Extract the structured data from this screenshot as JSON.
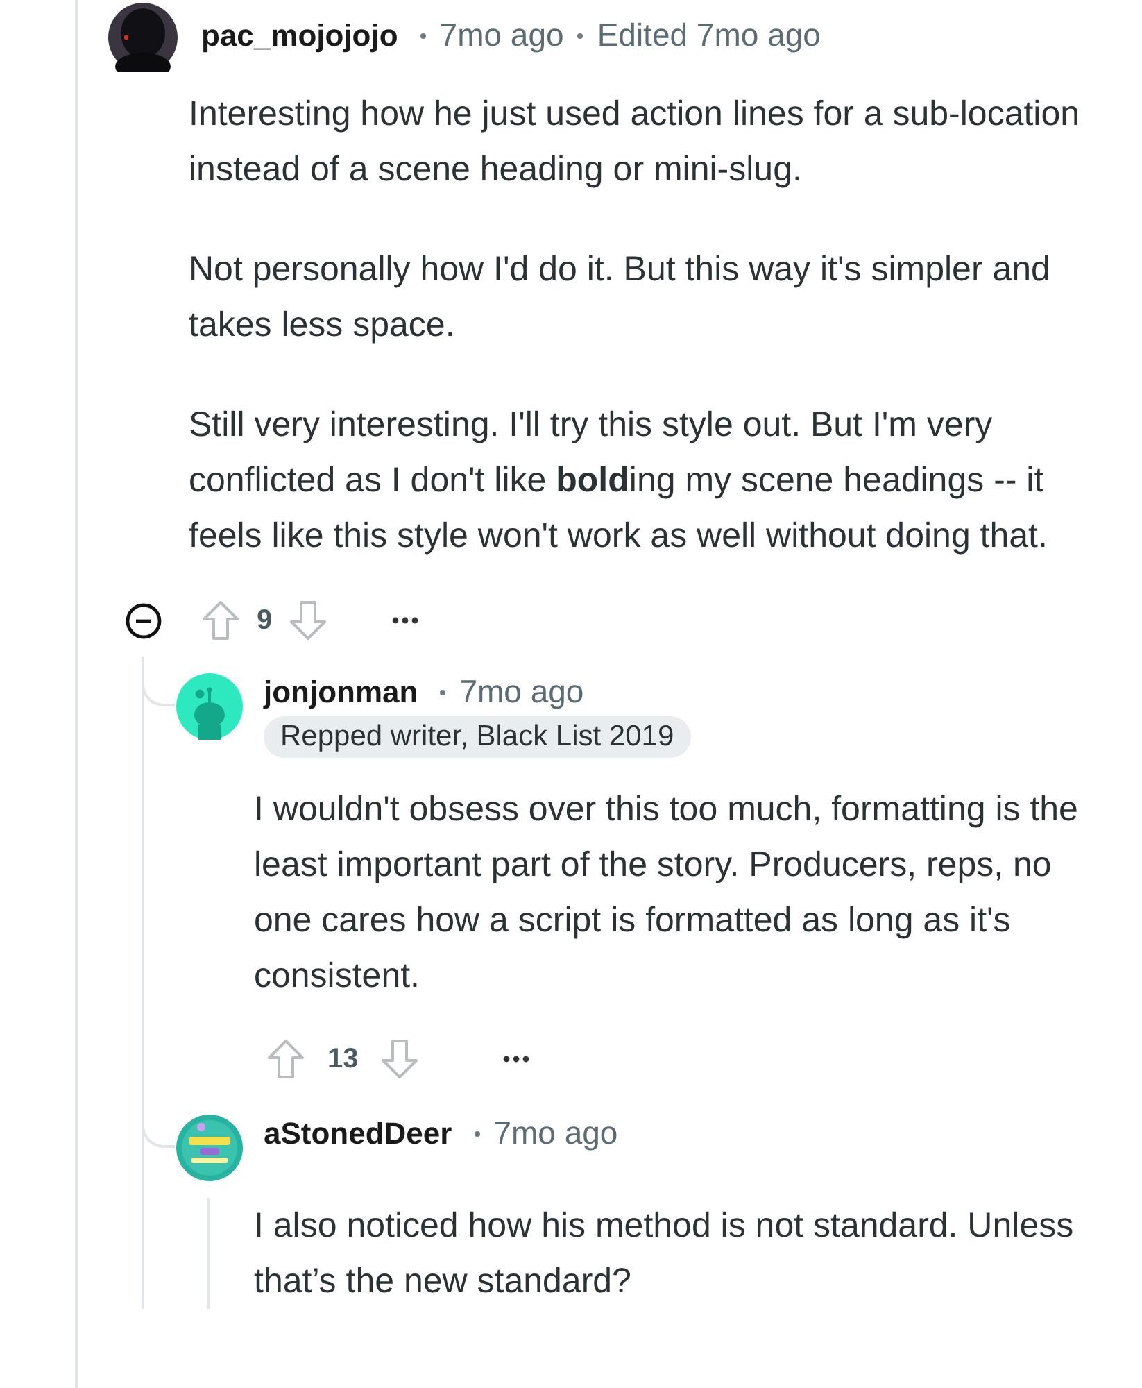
{
  "comments": [
    {
      "author": "pac_mojojojo",
      "avatar": {
        "kind": "dark"
      },
      "meta": [
        "7mo ago",
        "Edited 7mo ago"
      ],
      "paragraphs": [
        "Interesting how he just used action lines for a sub-location instead of a scene heading or mini-slug.",
        "Not personally how I'd do it. But this way it's simpler and takes less space.",
        "Still very interesting. I'll try this style out. But I'm very conflicted as I don't like **bold**ing my scene headings -- it feels like this style won't work as well without doing that."
      ],
      "expanded": true,
      "votes": "9",
      "replies": [
        {
          "author": "jonjonman",
          "avatar": {
            "kind": "snoo"
          },
          "meta": [
            "7mo ago"
          ],
          "flair": "Repped writer, Black List 2019",
          "paragraphs": [
            "I wouldn't obsess over this too much, formatting is the least important part of the story. Producers, reps, no one cares how a script is formatted as long as it's consistent."
          ],
          "votes": "13"
        },
        {
          "author": "aStonedDeer",
          "avatar": {
            "kind": "badge"
          },
          "meta": [
            "7mo ago"
          ],
          "paragraphs": [
            "I also noticed how his method is not standard. Unless that’s the new standard?"
          ]
        }
      ]
    }
  ]
}
